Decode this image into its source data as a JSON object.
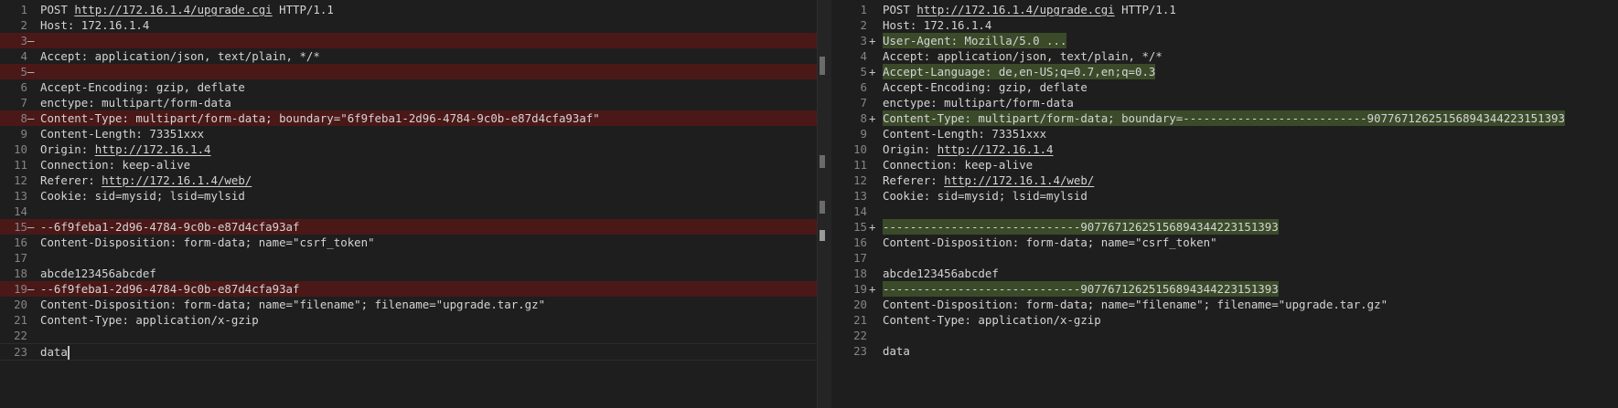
{
  "left": {
    "lines": [
      {
        "n": "1",
        "mark": "",
        "text": "POST http://172.16.1.4/upgrade.cgi HTTP/1.1",
        "type": "normal"
      },
      {
        "n": "2",
        "mark": "",
        "text": "Host: 172.16.1.4",
        "type": "normal"
      },
      {
        "n": "3",
        "mark": "—",
        "text": "",
        "type": "del"
      },
      {
        "n": "4",
        "mark": "",
        "text": "Accept: application/json, text/plain, */*",
        "type": "normal"
      },
      {
        "n": "5",
        "mark": "—",
        "text": "",
        "type": "del"
      },
      {
        "n": "6",
        "mark": "",
        "text": "Accept-Encoding: gzip, deflate",
        "type": "normal"
      },
      {
        "n": "7",
        "mark": "",
        "text": "enctype: multipart/form-data",
        "type": "normal"
      },
      {
        "n": "8",
        "mark": "—",
        "text": "Content-Type: multipart/form-data; boundary=\"6f9feba1-2d96-4784-9c0b-e87d4cfa93af\"",
        "type": "del"
      },
      {
        "n": "9",
        "mark": "",
        "text": "Content-Length: 73351xxx",
        "type": "normal"
      },
      {
        "n": "10",
        "mark": "",
        "text": "Origin: http://172.16.1.4",
        "type": "normal"
      },
      {
        "n": "11",
        "mark": "",
        "text": "Connection: keep-alive",
        "type": "normal"
      },
      {
        "n": "12",
        "mark": "",
        "text": "Referer: http://172.16.1.4/web/",
        "type": "normal"
      },
      {
        "n": "13",
        "mark": "",
        "text": "Cookie: sid=mysid; lsid=mylsid",
        "type": "normal"
      },
      {
        "n": "14",
        "mark": "",
        "text": "",
        "type": "normal"
      },
      {
        "n": "15",
        "mark": "—",
        "text": "--6f9feba1-2d96-4784-9c0b-e87d4cfa93af",
        "type": "del"
      },
      {
        "n": "16",
        "mark": "",
        "text": "Content-Disposition: form-data; name=\"csrf_token\"",
        "type": "normal"
      },
      {
        "n": "17",
        "mark": "",
        "text": "",
        "type": "normal"
      },
      {
        "n": "18",
        "mark": "",
        "text": "abcde123456abcdef",
        "type": "normal"
      },
      {
        "n": "19",
        "mark": "—",
        "text": "--6f9feba1-2d96-4784-9c0b-e87d4cfa93af",
        "type": "del"
      },
      {
        "n": "20",
        "mark": "",
        "text": "Content-Disposition: form-data; name=\"filename\"; filename=\"upgrade.tar.gz\"",
        "type": "normal"
      },
      {
        "n": "21",
        "mark": "",
        "text": "Content-Type: application/x-gzip",
        "type": "normal"
      },
      {
        "n": "22",
        "mark": "",
        "text": "",
        "type": "normal"
      },
      {
        "n": "23",
        "mark": "",
        "text": "data",
        "type": "normal"
      }
    ]
  },
  "right": {
    "lines": [
      {
        "n": "1",
        "mark": "",
        "text": "POST http://172.16.1.4/upgrade.cgi HTTP/1.1",
        "type": "normal"
      },
      {
        "n": "2",
        "mark": "",
        "text": "Host: 172.16.1.4",
        "type": "normal"
      },
      {
        "n": "3",
        "mark": "+",
        "text": "User-Agent: Mozilla/5.0 ...",
        "type": "ins"
      },
      {
        "n": "4",
        "mark": "",
        "text": "Accept: application/json, text/plain, */*",
        "type": "normal"
      },
      {
        "n": "5",
        "mark": "+",
        "text": "Accept-Language: de,en-US;q=0.7,en;q=0.3",
        "type": "ins"
      },
      {
        "n": "6",
        "mark": "",
        "text": "Accept-Encoding: gzip, deflate",
        "type": "normal"
      },
      {
        "n": "7",
        "mark": "",
        "text": "enctype: multipart/form-data",
        "type": "normal"
      },
      {
        "n": "8",
        "mark": "+",
        "text": "Content-Type: multipart/form-data; boundary=---------------------------907767126251568943442231513​93",
        "type": "ins"
      },
      {
        "n": "9",
        "mark": "",
        "text": "Content-Length: 73351xxx",
        "type": "normal"
      },
      {
        "n": "10",
        "mark": "",
        "text": "Origin: http://172.16.1.4",
        "type": "normal"
      },
      {
        "n": "11",
        "mark": "",
        "text": "Connection: keep-alive",
        "type": "normal"
      },
      {
        "n": "12",
        "mark": "",
        "text": "Referer: http://172.16.1.4/web/",
        "type": "normal"
      },
      {
        "n": "13",
        "mark": "",
        "text": "Cookie: sid=mysid; lsid=mylsid",
        "type": "normal"
      },
      {
        "n": "14",
        "mark": "",
        "text": "",
        "type": "normal"
      },
      {
        "n": "15",
        "mark": "+",
        "text": "-----------------------------907767126251568943442231513​93",
        "type": "ins"
      },
      {
        "n": "16",
        "mark": "",
        "text": "Content-Disposition: form-data; name=\"csrf_token\"",
        "type": "normal"
      },
      {
        "n": "17",
        "mark": "",
        "text": "",
        "type": "normal"
      },
      {
        "n": "18",
        "mark": "",
        "text": "abcde123456abcdef",
        "type": "normal"
      },
      {
        "n": "19",
        "mark": "+",
        "text": "-----------------------------907767126251568943442231513​93",
        "type": "ins"
      },
      {
        "n": "20",
        "mark": "",
        "text": "Content-Disposition: form-data; name=\"filename\"; filename=\"upgrade.tar.gz\"",
        "type": "normal"
      },
      {
        "n": "21",
        "mark": "",
        "text": "Content-Type: application/x-gzip",
        "type": "normal"
      },
      {
        "n": "22",
        "mark": "",
        "text": "",
        "type": "normal"
      },
      {
        "n": "23",
        "mark": "",
        "text": "data",
        "type": "normal"
      }
    ]
  },
  "colors": {
    "deleted_line": "#4b1818",
    "inserted_line": "#3b4b2a",
    "background": "#1e1e1e"
  }
}
